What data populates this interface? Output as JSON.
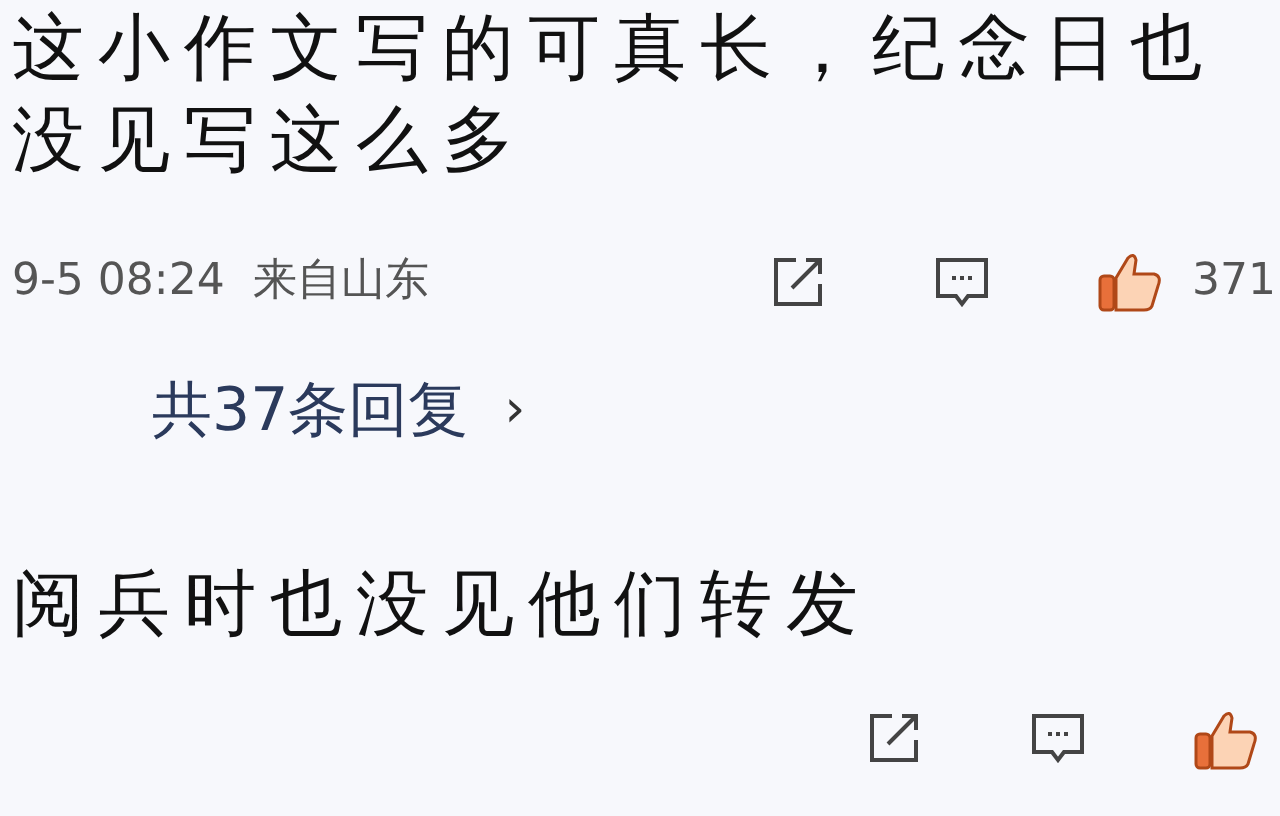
{
  "comments": [
    {
      "text": "这小作文写的可真长，纪念日也没见写这么多",
      "time": "9-5 08:24",
      "location": "来自山东",
      "likes": "371",
      "reply_link": "共37条回复",
      "reply_arrow": "›",
      "kind": "full"
    },
    {
      "text": "阅兵时也没见他们转发",
      "kind": "cut"
    }
  ]
}
